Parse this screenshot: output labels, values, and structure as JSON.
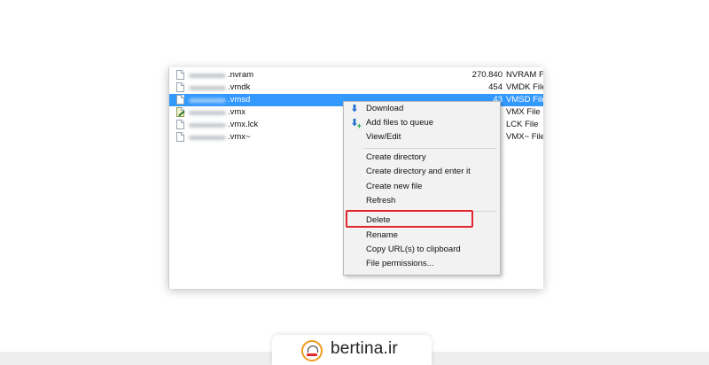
{
  "files": [
    {
      "name_suffix": ".nvram",
      "size": "270.840",
      "type": "NVRAM F",
      "icon": "file-icon"
    },
    {
      "name_suffix": ".vmdk",
      "size": "454",
      "type": "VMDK File",
      "icon": "file-icon"
    },
    {
      "name_suffix": ".vmsd",
      "size": "43",
      "type": "VMSD File",
      "icon": "file-icon",
      "selected": true
    },
    {
      "name_suffix": ".vmx",
      "size": "",
      "type": "VMX File",
      "icon": "edit-file-icon"
    },
    {
      "name_suffix": ".vmx.lck",
      "size": "",
      "type": "LCK File",
      "icon": "file-icon"
    },
    {
      "name_suffix": ".vmx~",
      "size": "",
      "type": "VMX~ File",
      "icon": "file-icon"
    }
  ],
  "context_menu": {
    "download": "Download",
    "add_to_queue": "Add files to queue",
    "view_edit": "View/Edit",
    "create_directory": "Create directory",
    "create_directory_enter": "Create directory and enter it",
    "create_new_file": "Create new file",
    "refresh": "Refresh",
    "delete": "Delete",
    "rename": "Rename",
    "copy_url": "Copy URL(s) to clipboard",
    "file_permissions": "File permissions..."
  },
  "highlight_color": "#e2262d",
  "selection_color": "#3399ff",
  "brand": {
    "text": "bertina.ir",
    "accent": "#f29a1f"
  }
}
